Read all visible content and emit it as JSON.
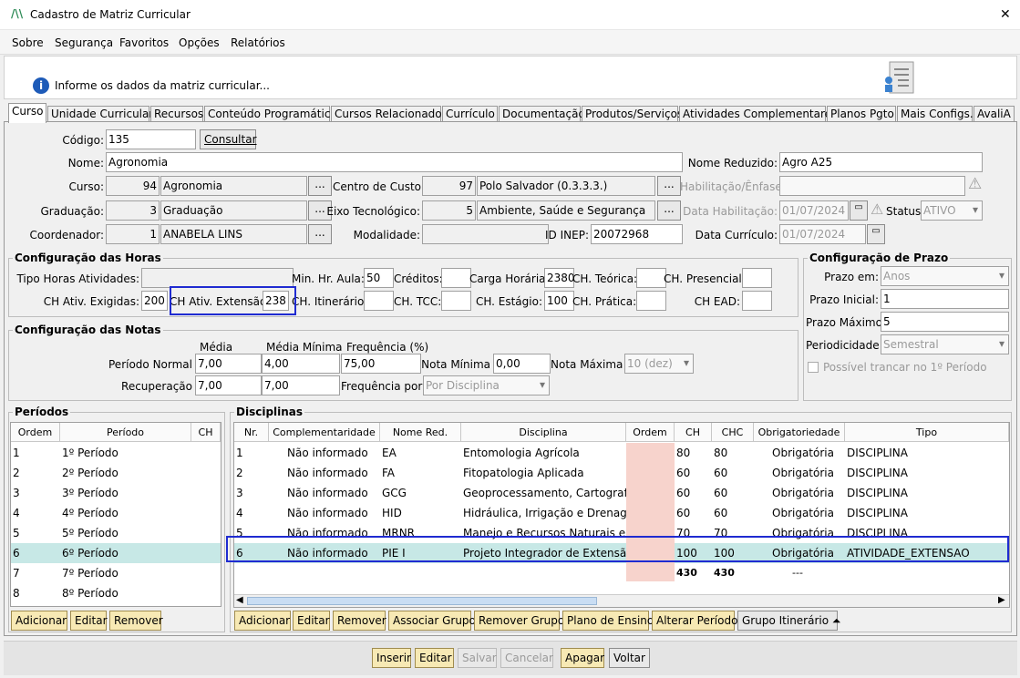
{
  "window": {
    "title": "Cadastro de Matriz Curricular",
    "close": "✕"
  },
  "menu": [
    "Sobre",
    "Segurança",
    "Favoritos",
    "Opções",
    "Relatórios"
  ],
  "info": {
    "text": "Informe os dados da matriz curricular..."
  },
  "tabs": [
    "Curso",
    "Unidade Curricular",
    "Recursos",
    "Conteúdo Programático",
    "Cursos Relacionados",
    "Currículo",
    "Documentação",
    "Produtos/Serviços",
    "Atividades Complementares",
    "Planos Pgto",
    "Mais Configs.",
    "AvaliA"
  ],
  "form": {
    "codigo_label": "Código:",
    "codigo": "135",
    "consultar": "Consultar",
    "nome_label": "Nome:",
    "nome": "Agronomia",
    "nome_reduzido_label": "Nome Reduzido:",
    "nome_reduzido": "Agro A25",
    "curso_label": "Curso:",
    "curso_cod": "94",
    "curso_nome": "Agronomia",
    "centro_label": "Centro de Custo:",
    "centro_cod": "97",
    "centro_nome": "Polo Salvador (0.3.3.3.)",
    "habilitacao_label": "Habilitação/Ênfase:",
    "graduacao_label": "Graduação:",
    "graduacao_cod": "3",
    "graduacao_nome": "Graduação",
    "eixo_label": "Eixo Tecnológico:",
    "eixo_cod": "5",
    "eixo_nome": "Ambiente, Saúde e Segurança",
    "data_hab_label": "Data Habilitação:",
    "data_hab": "01/07/2024",
    "status_label": "Status:",
    "status": "ATIVO",
    "coordenador_label": "Coordenador:",
    "coordenador_cod": "1",
    "coordenador_nome": "ANABELA LINS",
    "modalidade_label": "Modalidade:",
    "inep_label": "ID INEP:",
    "inep": "20072968",
    "data_curr_label": "Data Currículo:",
    "data_curr": "01/07/2024",
    "ellipsis": "..."
  },
  "horas": {
    "title": "Configuração das Horas",
    "tipo_label": "Tipo Horas Atividades:",
    "min_aula_label": "Min. Hr. Aula:",
    "min_aula": "50",
    "creditos_label": "Créditos:",
    "carga_label": "Carga Horária:",
    "carga": "2380",
    "ch_teorica_label": "CH. Teórica:",
    "ch_presencial_label": "CH. Presencial:",
    "ch_exig_label": "CH Ativ. Exigidas:",
    "ch_exig": "200",
    "ch_ext_label": "CH Ativ. Extensão:",
    "ch_ext": "238",
    "ch_itin_label": "CH. Itinerário:",
    "ch_tcc_label": "CH. TCC:",
    "ch_estagio_label": "CH. Estágio:",
    "ch_estagio": "100",
    "ch_pratica_label": "CH. Prática:",
    "ch_ead_label": "CH EAD:"
  },
  "prazo": {
    "title": "Configuração de Prazo",
    "em_label": "Prazo em:",
    "em": "Anos",
    "inicial_label": "Prazo Inicial:",
    "inicial": "1",
    "maximo_label": "Prazo Máximo:",
    "maximo": "5",
    "periodicidade_label": "Periodicidade:",
    "periodicidade": "Semestral",
    "trancar_label": "Possível trancar no 1º Período"
  },
  "notas": {
    "title": "Configuração das Notas",
    "media_h": "Média",
    "media_min_h": "Média Mínima",
    "freq_h": "Frequência (%)",
    "normal_label": "Período Normal",
    "normal_media": "7,00",
    "normal_min": "4,00",
    "normal_freq": "75,00",
    "nota_min_label": "Nota Mínima",
    "nota_min": "0,00",
    "nota_max_label": "Nota Máxima",
    "nota_max": "10 (dez)",
    "recup_label": "Recuperação",
    "recup_media": "7,00",
    "recup_min": "7,00",
    "freq_por_label": "Frequência por:",
    "freq_por": "Por Disciplina"
  },
  "periodos": {
    "title": "Períodos",
    "headers": [
      "Ordem",
      "Período",
      "CH"
    ],
    "rows": [
      [
        "1",
        "1º Período"
      ],
      [
        "2",
        "2º Período"
      ],
      [
        "3",
        "3º Período"
      ],
      [
        "4",
        "4º Período"
      ],
      [
        "5",
        "5º Período"
      ],
      [
        "6",
        "6º Período"
      ],
      [
        "7",
        "7º Período"
      ],
      [
        "8",
        "8º Período"
      ]
    ],
    "buttons": [
      "Adicionar",
      "Editar",
      "Remover"
    ]
  },
  "disciplinas": {
    "title": "Disciplinas",
    "headers": [
      "Nr.",
      "Complementaridade",
      "Nome Red.",
      "Disciplina",
      "Ordem",
      "CH",
      "CHC",
      "Obrigatoriedade",
      "Tipo"
    ],
    "rows": [
      [
        "1",
        "Não informado",
        "EA",
        "Entomologia Agrícola",
        "",
        "80",
        "80",
        "Obrigatória",
        "DISCIPLINA"
      ],
      [
        "2",
        "Não informado",
        "FA",
        "Fitopatologia Aplicada",
        "",
        "60",
        "60",
        "Obrigatória",
        "DISCIPLINA"
      ],
      [
        "3",
        "Não informado",
        "GCG",
        "Geoprocessamento, Cartografia e",
        "",
        "60",
        "60",
        "Obrigatória",
        "DISCIPLINA"
      ],
      [
        "4",
        "Não informado",
        "HID",
        "Hidráulica, Irrigação e Drenagem",
        "",
        "60",
        "60",
        "Obrigatória",
        "DISCIPLINA"
      ],
      [
        "5",
        "Não informado",
        "MRNR",
        "Manejo e Recursos Naturais e Ener",
        "",
        "70",
        "70",
        "Obrigatória",
        "DISCIPLINA"
      ],
      [
        "6",
        "Não informado",
        "PIE I",
        "Projeto Integrador de Extensão I",
        "",
        "100",
        "100",
        "Obrigatória",
        "ATIVIDADE_EXTENSAO"
      ]
    ],
    "totals": {
      "ch": "430",
      "chc": "430",
      "obrig": "---"
    },
    "buttons": [
      "Adicionar",
      "Editar",
      "Remover",
      "Associar Grupo",
      "Remover Grupo",
      "Plano de Ensino",
      "Alterar Período",
      "Grupo Itinerário ⏶"
    ]
  },
  "bottom": [
    "Inserir",
    "Editar",
    "Salvar",
    "Cancelar",
    "Apagar",
    "Voltar"
  ],
  "colors": {
    "selected_row": "#c7e8e6",
    "ordem_cell": "#f7d3cc",
    "highlight": "#1f2bd1",
    "tab_border": "#999999"
  }
}
